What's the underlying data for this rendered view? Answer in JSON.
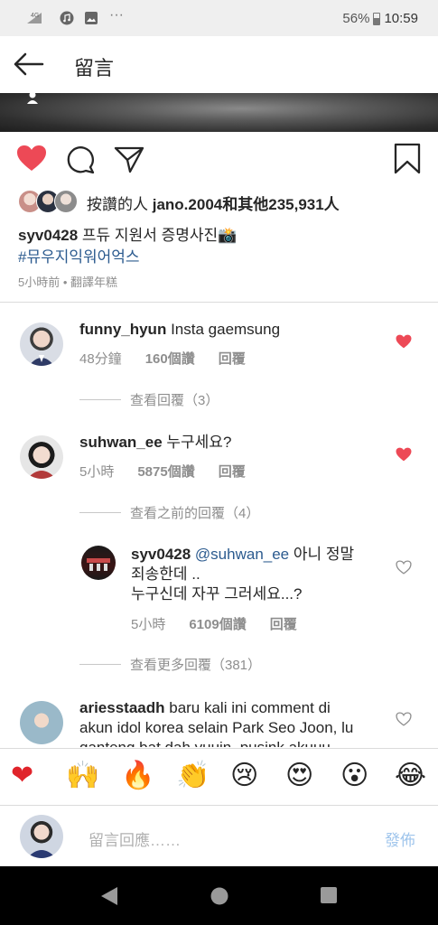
{
  "status_bar": {
    "network": "4G",
    "battery": "56%",
    "time": "10:59"
  },
  "header": {
    "title": "留言"
  },
  "post": {
    "likes_prefix": "按讚的人",
    "likes_user": "jano.2004",
    "likes_mid": "和其他",
    "likes_count": "235,931人",
    "caption_user": "syv0428",
    "caption_text": "프듀 지원서 증명사진📸",
    "hashtag": "#뮤우지익워어억스",
    "time": "5小時前",
    "translate": "翻譯年糕",
    "time_sep": " • "
  },
  "comments": [
    {
      "user": "funny_hyun",
      "text": "Insta gaemsung",
      "time": "48分鐘",
      "likes": "160個讚",
      "reply": "回覆",
      "liked": true,
      "view_replies": "查看回覆（3）"
    },
    {
      "user": "suhwan_ee",
      "text": "누구세요?",
      "time": "5小時",
      "likes": "5875個讚",
      "reply": "回覆",
      "liked": true,
      "view_replies": "查看之前的回覆（4）"
    }
  ],
  "reply": {
    "user": "syv0428",
    "mention": "@suhwan_ee",
    "text1": "아니 정말",
    "text2": "죄송한데 ..",
    "text3": "누구신데 자꾸 그러세요...?",
    "time": "5小時",
    "likes": "6109個讚",
    "reply": "回覆",
    "view_more": "查看更多回覆（381）"
  },
  "comment3": {
    "user": "ariesstaadh",
    "text1": "baru kali ini comment di",
    "text2": "akun idol korea selain Park Seo Joon, lu",
    "text3": "ganteng bat dah yuuin, pusink akuuu"
  },
  "emoji_bar": [
    "❤",
    "🙌",
    "🔥",
    "👏",
    "😢",
    "😍",
    "😮",
    "😂"
  ],
  "input": {
    "placeholder": "留言回應……",
    "post_label": "發佈"
  },
  "colors": {
    "like_red": "#ed4956",
    "link_blue": "#2c5b8f",
    "post_blue": "#9fc5ec"
  }
}
